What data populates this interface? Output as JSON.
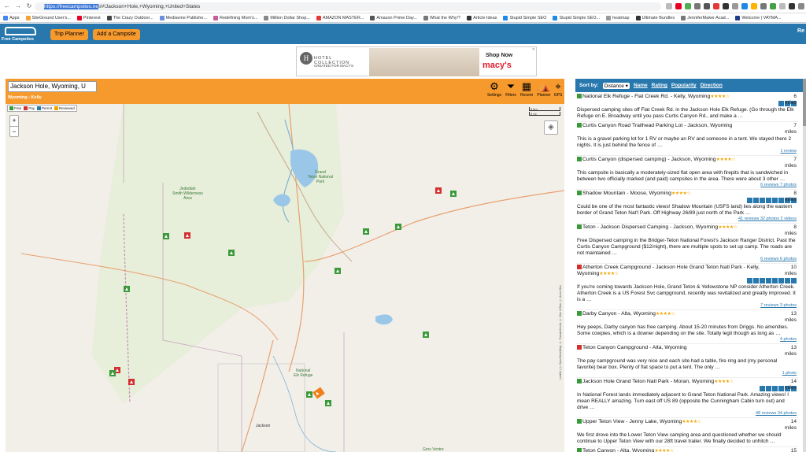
{
  "browser": {
    "url_selected": "https://freecampsites.ne",
    "url_rest": "t/#!Jackson+Hole,+Wyoming,+United+States",
    "bookmarks": [
      "Apps",
      "SiteGround User's...",
      "Pinterest",
      "The Crazy Outdoor...",
      "Mediavine Publishe...",
      "Redefining Mom's...",
      "Million Dollar Shop...",
      "AMAZON MASTER...",
      "Amazon Prime Day...",
      "What the Why!?",
      "Article Ideas",
      "Stupid Simple SEO",
      "Stupid Simple SEO...",
      "heatmap",
      "Ultimate Bundles",
      "JenniferMaker Acad...",
      "Welcome | VAYMA..."
    ]
  },
  "header": {
    "logo": "Free Campsites",
    "trip_planner": "Trip Planner",
    "add_campsite": "Add a Campsite",
    "right_text": "Re"
  },
  "ad": {
    "brand_top": "HOTEL COLLECTION",
    "brand_sub": "CREATED FOR MACY'S",
    "shop": "Shop Now",
    "store": "macy's"
  },
  "map": {
    "search_value": "Jackson Hole, Wyoming, U",
    "crumb_state": "Wyoming",
    "crumb_sep": " › ",
    "crumb_town": "Kelly",
    "tools": {
      "settings": "Settings",
      "filters": "Filters",
      "recent": "Recent",
      "planner": "Planner",
      "gps": "GPS"
    },
    "legend": [
      "Free",
      "Pay",
      "Permit",
      "Reviewed"
    ],
    "zoom_in": "+",
    "zoom_out": "−",
    "scale_km": "5 km",
    "scale_mi": "5 mi",
    "labels": {
      "jedediah": "Jedediah\nSmith Wilderness\nArea",
      "grand_teton": "Grand\nTeton National\nPark",
      "elk_refuge": "National\nElk Refuge",
      "jackson": "Jackson",
      "gros_ventre": "Gros Ventre"
    },
    "copyright": "Leaflet | © OpenStreetMap, © Thunderforest, © Hike & Bike, © Acme Dev"
  },
  "sort": {
    "label": "Sort by:",
    "selected": "Distance",
    "options": [
      "Name",
      "Rating",
      "Popularity",
      "Direction"
    ]
  },
  "sites": [
    {
      "type": "green",
      "name": "National Elk Refuge - Flat Creek Rd. - Kelly, Wyoming",
      "stars": "★★★★☆",
      "dist": "6",
      "unit": "miles",
      "desc": "Dispersed camping sites off Flat Creek Rd. in the Jackson Hole Elk Refuge. (Go through the Elk Refuge on E. Broadway until you pass Curtis Canyon Rd., and make a …",
      "meta": ""
    },
    {
      "type": "green",
      "name": "Curtis Canyon Road Trailhead Parking Lot - Jackson, Wyoming",
      "stars": "",
      "dist": "7",
      "unit": "miles",
      "desc": "This is a gravel parking lot for 1 RV or maybe an RV and someone in a tent. We stayed there 2 nights. It is just behind the fence of …",
      "meta": "1 review"
    },
    {
      "type": "green",
      "name": "Curtis Canyon (dispersed camping) - Jackson, Wyoming",
      "stars": "★★★★☆",
      "dist": "7",
      "unit": "miles",
      "desc": "This campsite is basically a moderately-sized flat open area with firepits that is sandwiched in between two officially marked (and paid) campsites in the area. There were about 3 other …",
      "meta": "6 reviews 7 photos"
    },
    {
      "type": "green",
      "name": "Shadow Mountain - Moose, Wyoming",
      "stars": "★★★★☆",
      "dist": "8",
      "unit": "miles",
      "desc": "Could be one of the most fantastic views! Shadow Mountain (USFS land) lies along the eastern border of Grand Teton Nat'l Park. Off Highway 26/89 just north of the Park …",
      "meta": "41 reviews 32 photos 2 videos"
    },
    {
      "type": "green",
      "name": "Teton - Jackson Dispersed Camping - Jackson, Wyoming",
      "stars": "★★★★☆",
      "dist": "8",
      "unit": "miles",
      "desc": "Free Dispersed camping in the Bridger-Teton National Forest's Jackson Ranger District. Past the Curtis Canyon Campground ($12/night), there are multiple spots to set up camp. The roads are not maintained …",
      "meta": "6 reviews 6 photos"
    },
    {
      "type": "red",
      "name": "Atherton Creek Campground - Jackson Hole Grand Teton Natl Park - Kelly, Wyoming",
      "stars": "★★★★☆",
      "dist": "10",
      "unit": "miles",
      "desc": "If you're coming towards Jackson Hole, Grand Teton & Yellowstone NP consider Atherton Creek. Atherton Creek is a US Forest Svc campground, recently was revitalized and greatly improved. It is a …",
      "meta": "7 reviews 3 photos"
    },
    {
      "type": "green",
      "name": "Darby Canyon - Alta, Wyoming",
      "stars": "★★★★☆",
      "dist": "13",
      "unit": "miles",
      "desc": "Hey peeps, Darby canyon has free camping. About 15-20 minutes from Driggs. No amenities. Some cowpies, which is a downer depending on the site. Totally legit though as long as …",
      "meta": "4 photos"
    },
    {
      "type": "red",
      "name": "Teton Canyon Campground - Alta, Wyoming",
      "stars": "",
      "dist": "13",
      "unit": "miles",
      "desc": "The pay campground was very nice and each site had a table, fire ring and (my personal favorite) bear box. Plenty of flat space to put a tent. The only …",
      "meta": "1 photo"
    },
    {
      "type": "green",
      "name": "Jackson Hole Grand Teton Natl Park - Moran, Wyoming",
      "stars": "★★★★☆",
      "dist": "14",
      "unit": "miles",
      "desc": "In National Forest lands immediately adjacent to Grand Teton National Park. Amazing views! I mean REALLY amazing. Turn east off US 89 (opposite the Cunningham Cabin turn out) and drive …",
      "meta": "48 reviews 34 photos"
    },
    {
      "type": "green",
      "name": "Upper Teton View - Jenny Lake, Wyoming",
      "stars": "★★★★☆",
      "dist": "14",
      "unit": "miles",
      "desc": "We first drove into the Lower Teton View camping area and questioned whether we should continue to Upper Teton View with our 28ft travel trailer. We finally decided to unhitch …",
      "meta": ""
    },
    {
      "type": "green",
      "name": "Teton Canyon - Alta, Wyoming",
      "stars": "★★★★☆",
      "dist": "15",
      "unit": "miles",
      "desc": "",
      "meta": ""
    }
  ]
}
